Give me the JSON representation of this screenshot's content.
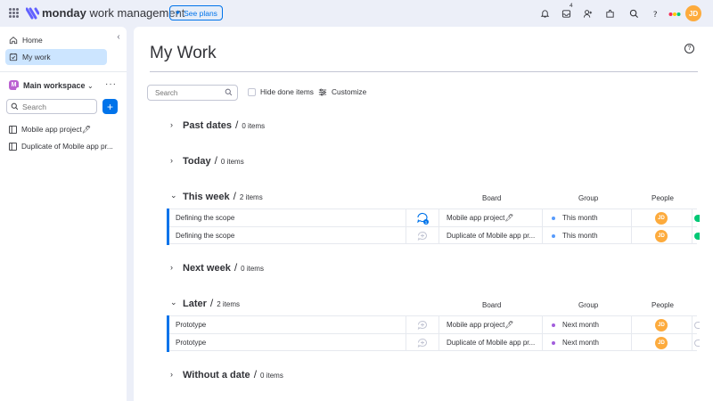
{
  "topbar": {
    "brand_bold": "monday",
    "brand_rest": "work management",
    "see_plans": "See plans",
    "inbox_count": "4",
    "avatar_initials": "JD"
  },
  "sidebar": {
    "nav": [
      {
        "label": "Home",
        "icon": "home-icon"
      },
      {
        "label": "My work",
        "icon": "calendar-check-icon",
        "active": true
      }
    ],
    "workspace_badge": "M",
    "workspace_name": "Main workspace",
    "search_placeholder": "Search",
    "boards": [
      {
        "label": "Mobile app project🖊"
      },
      {
        "label": "Duplicate of Mobile app pr..."
      }
    ]
  },
  "main": {
    "title": "My Work",
    "search_placeholder": "Search",
    "hide_done_label": "Hide done items",
    "customize_label": "Customize",
    "columns": {
      "board": "Board",
      "group": "Group",
      "people": "People"
    },
    "sections": [
      {
        "title": "Past dates",
        "count": "0 items"
      },
      {
        "title": "Today",
        "count": "0 items"
      },
      {
        "title": "This week",
        "count": "2 items",
        "rows": [
          {
            "name": "Defining the scope",
            "board": "Mobile app project🖊",
            "group": "This month",
            "group_color": "#579bfc",
            "person": "JD",
            "update_count": "1"
          },
          {
            "name": "Defining the scope",
            "board": "Duplicate of Mobile app pr...",
            "group": "This month",
            "group_color": "#579bfc",
            "person": "JD"
          }
        ]
      },
      {
        "title": "Next week",
        "count": "0 items"
      },
      {
        "title": "Later",
        "count": "2 items",
        "rows": [
          {
            "name": "Prototype",
            "board": "Mobile app project🖊",
            "group": "Next month",
            "group_color": "#a25ddc",
            "person": "JD"
          },
          {
            "name": "Prototype",
            "board": "Duplicate of Mobile app pr...",
            "group": "Next month",
            "group_color": "#a25ddc",
            "person": "JD"
          }
        ]
      },
      {
        "title": "Without a date",
        "count": "0 items"
      }
    ]
  },
  "colors": {
    "accent": "#0073ea",
    "sidebar_active": "#cce5ff",
    "avatar": "#fdab3d",
    "workspace_badge": "#bb62d1",
    "status_green": "#00c875"
  }
}
